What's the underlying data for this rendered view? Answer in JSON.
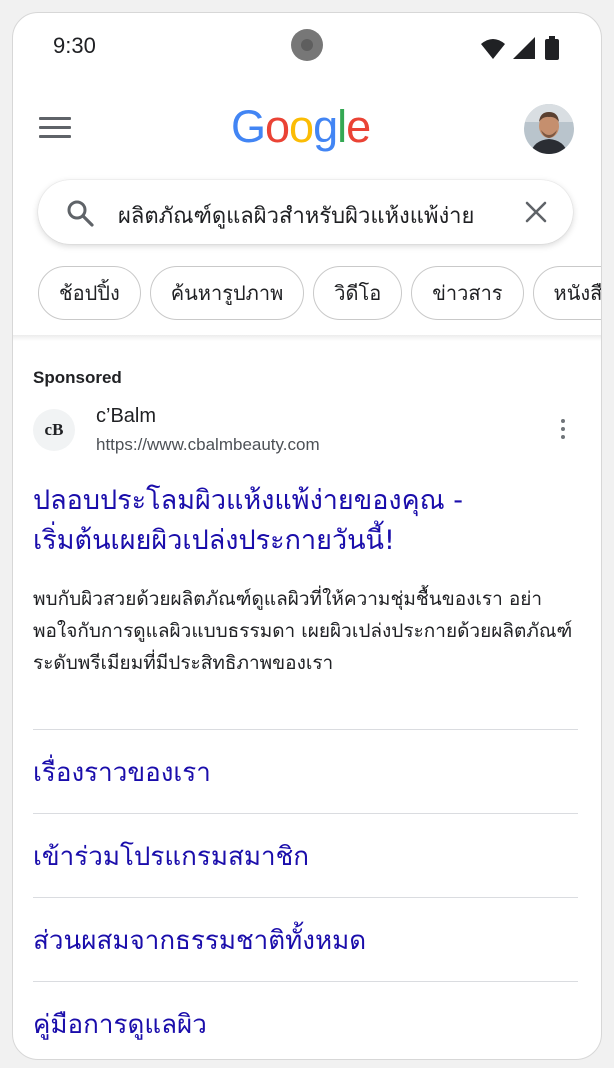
{
  "status_bar": {
    "time": "9:30",
    "icons": [
      "wifi-icon",
      "cellular-signal-icon",
      "battery-icon"
    ]
  },
  "header": {
    "menu_icon": "hamburger-menu-icon",
    "logo": "Google",
    "logo_colors": [
      "#4285F4",
      "#EA4335",
      "#FBBC05",
      "#4285F4",
      "#34A853",
      "#EA4335"
    ],
    "avatar_icon": "user-avatar"
  },
  "search": {
    "query": "ผลิตภัณฑ์ดูแลผิวสำหรับผิวแห้งแพ้ง่าย",
    "search_icon": "search-icon",
    "clear_icon": "close-icon"
  },
  "tabs": [
    {
      "label": "ช้อปปิ้ง"
    },
    {
      "label": "ค้นหารูปภาพ"
    },
    {
      "label": "วิดีโอ"
    },
    {
      "label": "ข่าวสาร"
    },
    {
      "label": "หนังสือ"
    }
  ],
  "ad": {
    "sponsored_label": "Sponsored",
    "favicon_text": "cB",
    "site_name": "c’Balm",
    "url": "https://www.cbalmbeauty.com",
    "title_line1": "ปลอบประโลมผิวแห้งแพ้ง่ายของคุณ -",
    "title_line2": "เริ่มต้นเผยผิวเปล่งประกายวันนี้!",
    "description": "พบกับผิวสวยด้วยผลิตภัณฑ์ดูแลผิวที่ให้ความชุ่มชื้นของเรา อย่าพอใจกับการดูแลผิวแบบธรรมดา เผยผิวเปล่งประกายด้วยผลิตภัณฑ์ระดับพรีเมียมที่มีประสิทธิภาพของเรา",
    "title_color": "#1a0dab"
  },
  "sitelinks": [
    {
      "label": "เรื่องราวของเรา"
    },
    {
      "label": "เข้าร่วมโปรแกรมสมาชิก"
    },
    {
      "label": "ส่วนผสมจากธรรมชาติทั้งหมด"
    },
    {
      "label": "คู่มือการดูแลผิว"
    }
  ]
}
